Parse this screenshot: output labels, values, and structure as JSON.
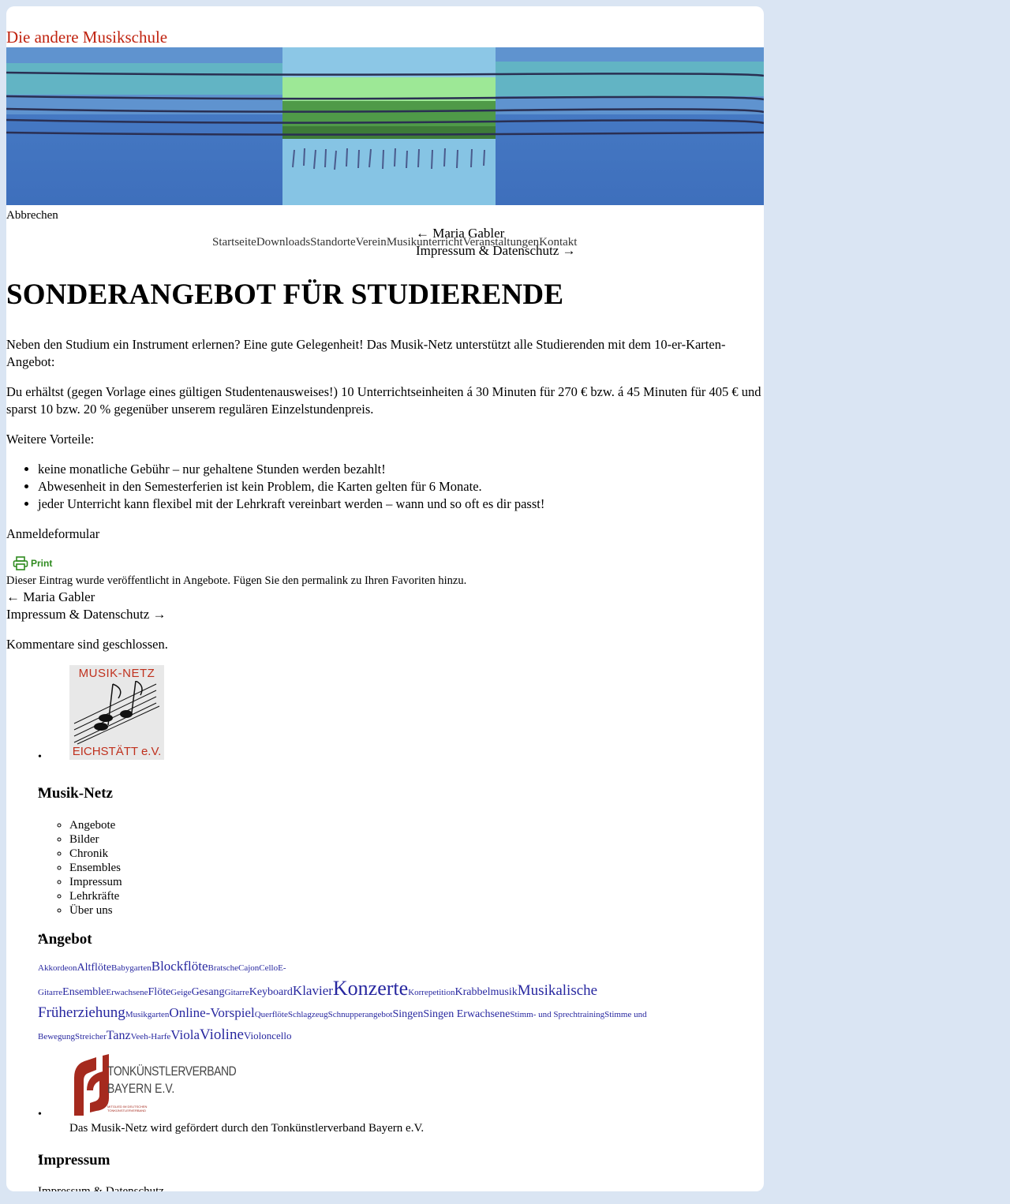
{
  "site": {
    "title": "Die andere Musikschule"
  },
  "header": {
    "cancel_label": "Abbrechen"
  },
  "nav": [
    "Startseite",
    "Downloads",
    "Standorte",
    "Verein",
    "Musikunterricht",
    "Veranstaltungen",
    "Kontakt"
  ],
  "post_nav": {
    "prev": "← Maria Gabler",
    "next": "Impressum & Datenschutz →"
  },
  "post": {
    "title": "SONDERANGEBOT FÜR STUDIERENDE",
    "p1": "Neben den Studium ein Instrument erlernen? Eine gute Gelegenheit! Das Musik-Netz unterstützt alle Studierenden mit dem 10-er-Karten-Angebot:",
    "p2": "Du erhältst (gegen Vorlage eines gültigen Studentenausweises!) 10 Unterrichtseinheiten á 30 Minuten für 270 € bzw. á 45 Minuten für 405 € und sparst 10 bzw. 20 % gegenüber unserem regulären Einzelstundenpreis.",
    "p3": "Weitere Vorteile:",
    "bullets": [
      "keine monatliche Gebühr – nur gehaltene Stunden werden bezahlt!",
      "Abwesenheit in den Semesterferien ist kein Problem, die Karten gelten für 6 Monate.",
      "jeder Unterricht kann flexibel mit der Lehrkraft vereinbart werden – wann und so oft es dir passt!"
    ],
    "form_link": "Anmeldeformular",
    "print_label": "Print",
    "meta": "Dieser Eintrag wurde veröffentlicht in Angebote. Fügen Sie den permalink zu Ihren Favoriten hinzu.",
    "comments_closed": "Kommentare sind geschlossen."
  },
  "sidebar": {
    "logo_text_top": "MUSIK-NETZ",
    "logo_text_bottom": "EICHSTÄTT e.V.",
    "musik_netz": {
      "heading": "Musik-Netz",
      "items": [
        "Angebote",
        "Bilder",
        "Chronik",
        "Ensembles",
        "Impressum",
        "Lehrkräfte",
        "Über uns"
      ]
    },
    "angebot": {
      "heading": "Angebot",
      "tags": [
        {
          "t": "Akkordeon",
          "s": 11
        },
        {
          "t": "Altflöte",
          "s": 14
        },
        {
          "t": "Babygarten",
          "s": 11
        },
        {
          "t": "Blockflöte",
          "s": 17
        },
        {
          "t": "Bratsche",
          "s": 11
        },
        {
          "t": "Cajon",
          "s": 11
        },
        {
          "t": "Cello",
          "s": 11
        },
        {
          "t": "E-Gitarre",
          "s": 11
        },
        {
          "t": "Ensemble",
          "s": 14
        },
        {
          "t": "Erwachsene",
          "s": 11
        },
        {
          "t": "Flöte",
          "s": 14
        },
        {
          "t": "Geige",
          "s": 11
        },
        {
          "t": "Gesang",
          "s": 14
        },
        {
          "t": "Gitarre",
          "s": 11
        },
        {
          "t": "Keyboard",
          "s": 14
        },
        {
          "t": "Klavier",
          "s": 17
        },
        {
          "t": "Konzerte",
          "s": 26
        },
        {
          "t": "Korrepetition",
          "s": 11
        },
        {
          "t": "Krabbelmusik",
          "s": 14
        },
        {
          "t": "Musikalische Früherziehung",
          "s": 19
        },
        {
          "t": "Musikgarten",
          "s": 11
        },
        {
          "t": "Online-Vorspiel",
          "s": 17
        },
        {
          "t": "Querflöte",
          "s": 11
        },
        {
          "t": "Schlagzeug",
          "s": 11
        },
        {
          "t": "Schnupperangebot",
          "s": 11
        },
        {
          "t": "Singen",
          "s": 14
        },
        {
          "t": "Singen Erwachsene",
          "s": 14
        },
        {
          "t": "Stimm- und Sprechtraining",
          "s": 11
        },
        {
          "t": "Stimme und Bewegung",
          "s": 11
        },
        {
          "t": "Streicher",
          "s": 11
        },
        {
          "t": "Tanz",
          "s": 16
        },
        {
          "t": "Veeh-Harfe",
          "s": 11
        },
        {
          "t": "Viola",
          "s": 17
        },
        {
          "t": "Violine",
          "s": 19
        },
        {
          "t": "Violoncello",
          "s": 13
        }
      ]
    },
    "tkv": {
      "logo_line1": "TONKÜNSTLERVERBAND",
      "logo_line2": "BAYERN E.V.",
      "logo_small": "MITGLIED IM DEUTSCHEN TONKÜNSTLERVERBAND",
      "caption": "Das Musik-Netz wird gefördert durch den Tonkünstlerverband Bayern e.V."
    },
    "impressum": {
      "heading": "Impressum",
      "link": "Impressum & Datenschutz"
    }
  }
}
